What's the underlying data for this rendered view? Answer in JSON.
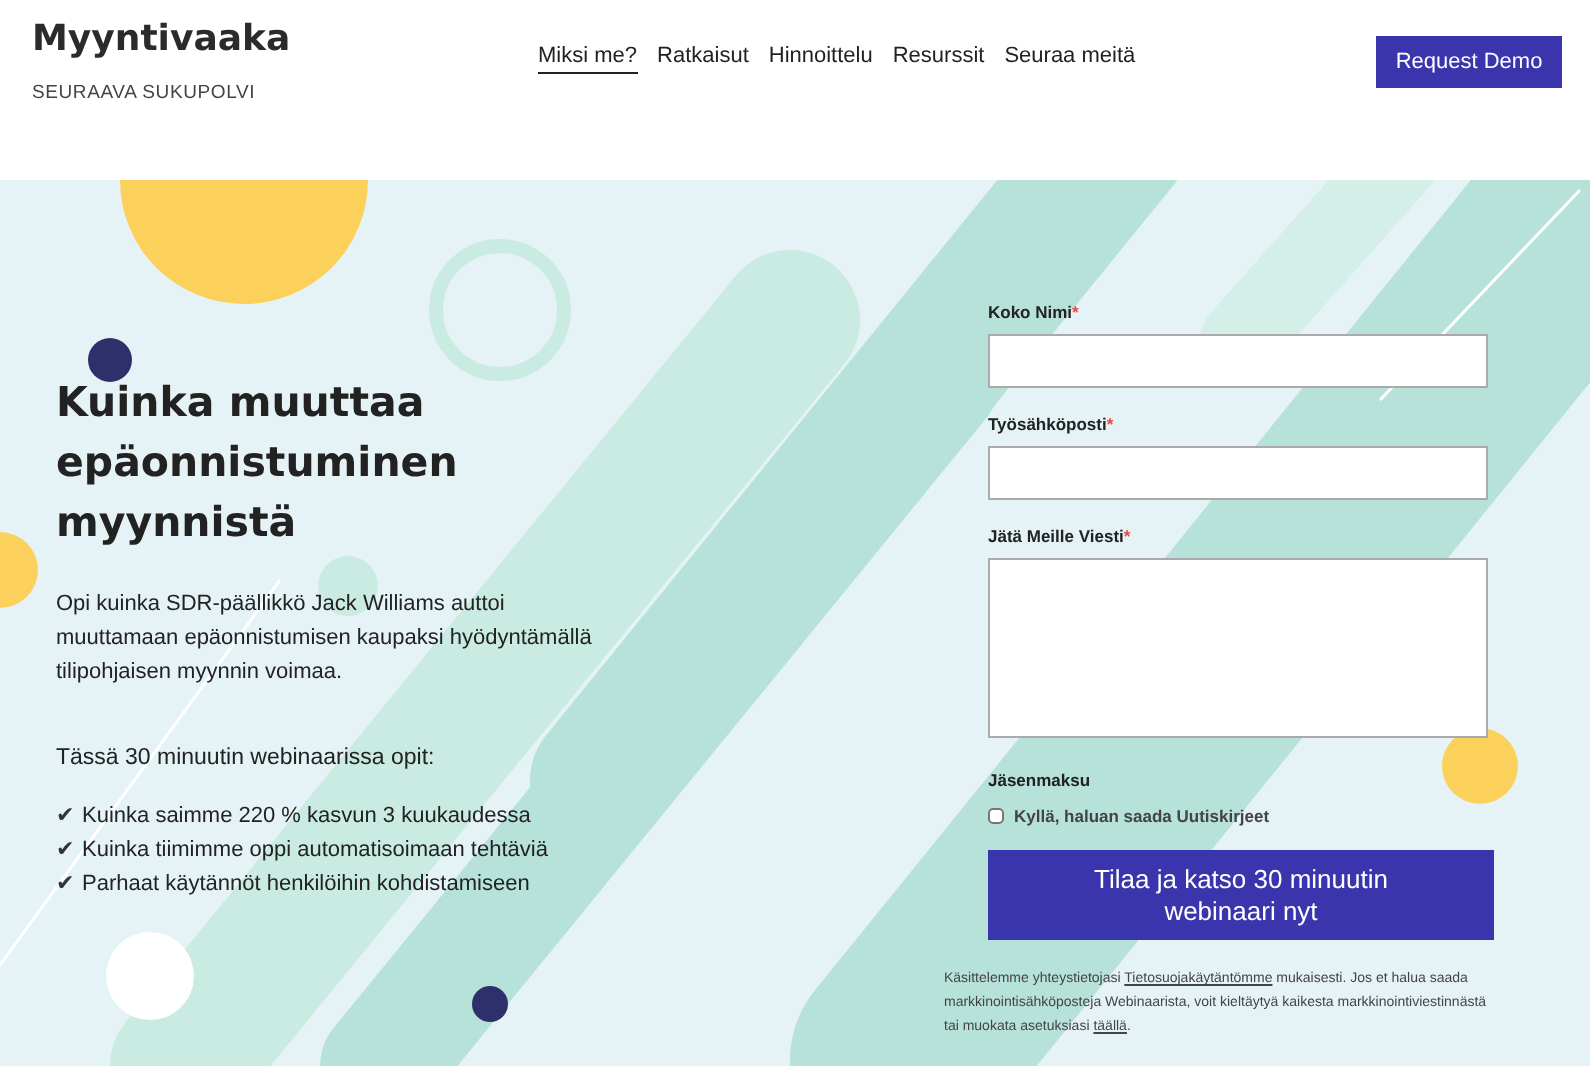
{
  "brand": {
    "name": "Myyntivaaka",
    "tagline": "SEURAAVA SUKUPOLVI"
  },
  "nav": [
    {
      "label": "Miksi me?",
      "selected": true
    },
    {
      "label": "Ratkaisut",
      "selected": false
    },
    {
      "label": "Hinnoittelu",
      "selected": false
    },
    {
      "label": "Resurssit",
      "selected": false
    },
    {
      "label": "Seuraa meitä",
      "selected": false
    }
  ],
  "cta_button": "Request Demo",
  "hero": {
    "title": "Kuinka muuttaa epäonnistuminen myynnistä",
    "intro": "Opi kuinka SDR-päällikkö Jack Williams auttoi muuttamaan epäonnistumisen kaupaksi hyödyntämällä tilipohjaisen myynnin voimaa.",
    "list_heading": "Tässä 30 minuutin webinaarissa opit:",
    "check_mark": "✔",
    "bullets": [
      "Kuinka saimme 220 % kasvun 3 kuukaudessa",
      "Kuinka tiimimme oppi automatisoimaan tehtäviä",
      "Parhaat käytännöt henkilöihin kohdistamiseen"
    ]
  },
  "form": {
    "fields": [
      {
        "label": "Koko Nimi",
        "required": true,
        "kind": "text"
      },
      {
        "label": "Työsähköposti",
        "required": true,
        "kind": "text"
      },
      {
        "label": "Jätä Meille Viesti",
        "required": true,
        "kind": "textarea"
      }
    ],
    "required_mark": "*",
    "group_label": "Jäsenmaksu",
    "checkbox": {
      "label": "Kyllä, haluan saada Uutiskirjeet",
      "checked": false
    },
    "submit": "Tilaa ja katso 30 minuutin webinaari nyt",
    "privacy": [
      {
        "kind": "text",
        "text": "Käsittelemme yhteystietojasi"
      },
      {
        "kind": "link",
        "text": "Tietosuojakäytäntömme"
      },
      {
        "kind": "text",
        "text": "mukaisesti. Jos et halua saada markkinointisähköposteja Webinaarista, voit kieltäytyä kaikesta markkinointiviestinnästä tai muokata asetuksiasi"
      },
      {
        "kind": "link",
        "text": "täällä"
      },
      {
        "kind": "text",
        "text": "."
      }
    ]
  }
}
